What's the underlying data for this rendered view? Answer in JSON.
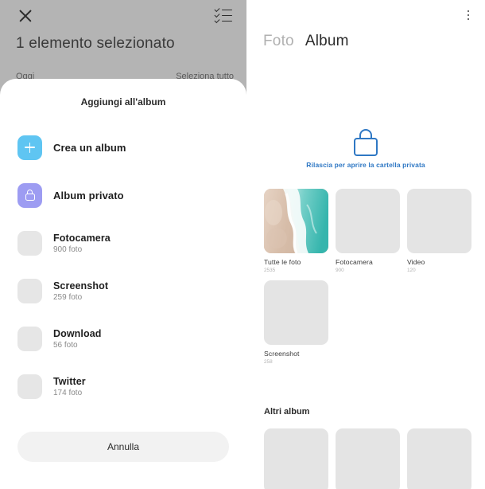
{
  "selection_screen": {
    "close_icon": "close-icon",
    "checklist_icon": "checklist-icon",
    "title": "1 elemento selezionato",
    "group_label": "Oggi",
    "select_all_label": "Seleziona tutto"
  },
  "sheet": {
    "title": "Aggiungi all'album",
    "cancel_label": "Annulla",
    "actions": [
      {
        "label": "Crea un album",
        "icon": "plus-icon",
        "color": "#5fc5f2"
      },
      {
        "label": "Album privato",
        "icon": "lock-icon",
        "color": "#9d9cf2"
      }
    ],
    "albums": [
      {
        "label": "Fotocamera",
        "count": "900 foto"
      },
      {
        "label": "Screenshot",
        "count": "259 foto"
      },
      {
        "label": "Download",
        "count": "56 foto"
      },
      {
        "label": "Twitter",
        "count": "174 foto"
      }
    ]
  },
  "albums_page": {
    "overflow_icon": "overflow-menu-icon",
    "tabs": [
      {
        "label": "Foto",
        "active": false
      },
      {
        "label": "Album",
        "active": true
      }
    ],
    "private_folder": {
      "icon": "lock-icon",
      "hint": "Rilascia per aprire la cartella privata",
      "accent": "#2f78c4"
    },
    "grid": [
      {
        "label": "Tutte le foto",
        "count": "2535",
        "thumb": "beach-photo"
      },
      {
        "label": "Fotocamera",
        "count": "900",
        "thumb": "placeholder"
      },
      {
        "label": "Video",
        "count": "120",
        "thumb": "placeholder"
      },
      {
        "label": "Screenshot",
        "count": "258",
        "thumb": "placeholder"
      }
    ],
    "other_section_title": "Altri album",
    "other_albums": [
      {
        "thumb": "placeholder"
      },
      {
        "thumb": "placeholder"
      },
      {
        "thumb": "placeholder"
      }
    ]
  }
}
